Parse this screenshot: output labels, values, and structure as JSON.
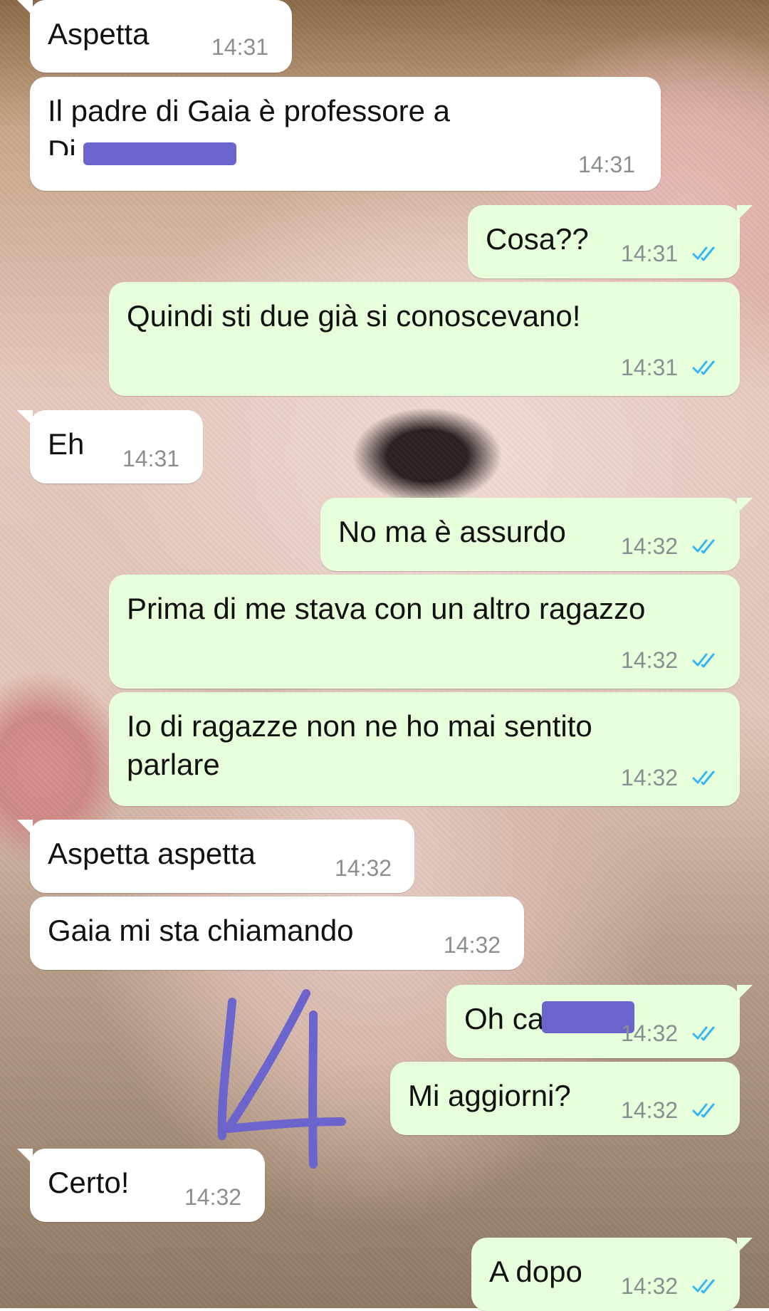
{
  "messages": [
    {
      "id": 1,
      "dir": "in",
      "text": "Aspetta",
      "time": "14:31"
    },
    {
      "id": 2,
      "dir": "in",
      "lines": [
        "Il padre di Gaia è professore a",
        "Di"
      ],
      "time": "14:31",
      "redacted": true
    },
    {
      "id": 3,
      "dir": "out",
      "text": "Cosa??",
      "time": "14:31",
      "read": true
    },
    {
      "id": 4,
      "dir": "out",
      "text": "Quindi sti due già si conoscevano!",
      "time": "14:31",
      "read": true
    },
    {
      "id": 5,
      "dir": "in",
      "text": "Eh",
      "time": "14:31"
    },
    {
      "id": 6,
      "dir": "out",
      "text": "No ma è assurdo",
      "time": "14:32",
      "read": true
    },
    {
      "id": 7,
      "dir": "out",
      "text": "Prima di me stava con un altro ragazzo",
      "time": "14:32",
      "read": true
    },
    {
      "id": 8,
      "dir": "out",
      "lines": [
        "Io di ragazze non ne ho mai sentito",
        "parlare"
      ],
      "time": "14:32",
      "read": true
    },
    {
      "id": 9,
      "dir": "in",
      "text": "Aspetta aspetta",
      "time": "14:32"
    },
    {
      "id": 10,
      "dir": "in",
      "text": "Gaia mi sta chiamando",
      "time": "14:32"
    },
    {
      "id": 11,
      "dir": "out",
      "text": "Oh ca",
      "time": "14:32",
      "read": true,
      "redacted": true
    },
    {
      "id": 12,
      "dir": "out",
      "text": "Mi aggiorni?",
      "time": "14:32",
      "read": true
    },
    {
      "id": 13,
      "dir": "in",
      "text": "Certo!",
      "time": "14:32"
    },
    {
      "id": 14,
      "dir": "out",
      "text": "A dopo",
      "time": "14:32",
      "read": true
    }
  ],
  "annotation": {
    "handwritten": "14"
  },
  "colors": {
    "incoming_bubble": "#ffffff",
    "outgoing_bubble": "#e7ffdb",
    "timestamp": "#8a8f91",
    "read_ticks": "#34b7f1",
    "redaction": "#6b64cc",
    "handwriting": "#6b64cc"
  },
  "icons": {
    "read_receipt": "double-check-icon"
  }
}
